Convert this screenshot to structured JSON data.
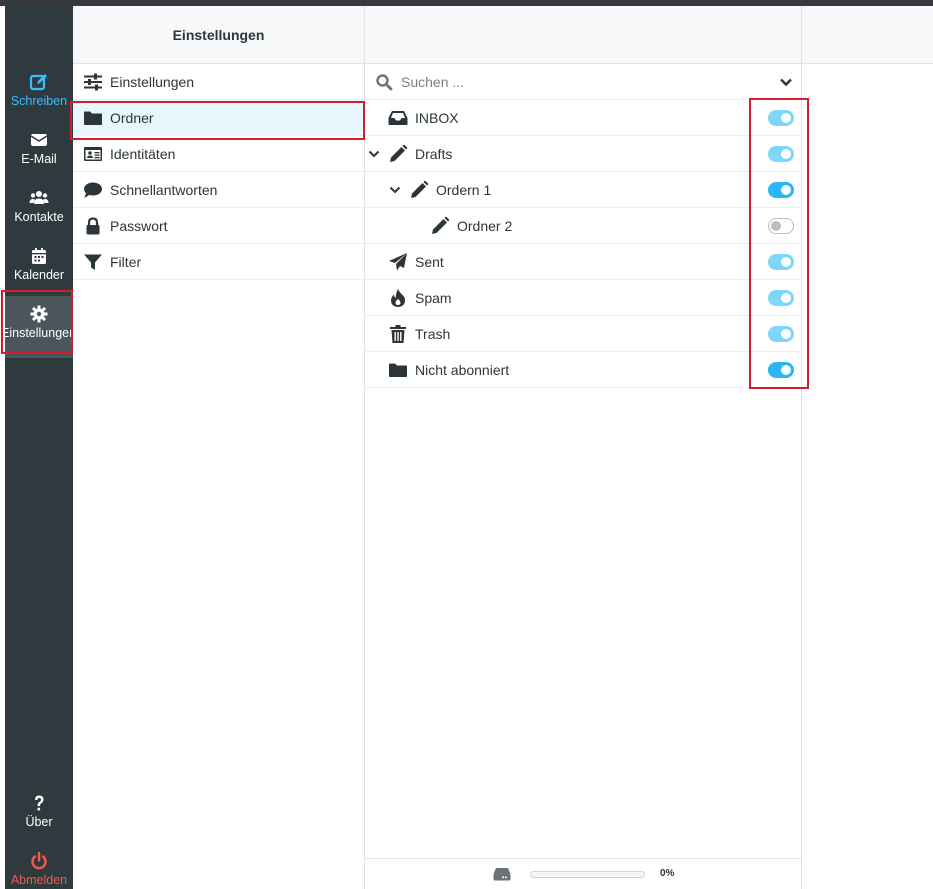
{
  "nav": {
    "compose": {
      "label": "Schreiben",
      "icon": "compose-icon"
    },
    "mail": {
      "label": "E-Mail",
      "icon": "envelope-icon"
    },
    "contacts": {
      "label": "Kontakte",
      "icon": "users-icon"
    },
    "calendar": {
      "label": "Kalender",
      "icon": "calendar-icon"
    },
    "settings": {
      "label": "Einstellungen",
      "icon": "gear-icon",
      "active": true
    },
    "about": {
      "label": "Über",
      "icon": "question-icon"
    },
    "logout": {
      "label": "Abmelden",
      "icon": "power-icon"
    }
  },
  "settings_column": {
    "title": "Einstellungen",
    "items": [
      {
        "label": "Einstellungen",
        "icon": "sliders-icon"
      },
      {
        "label": "Ordner",
        "icon": "folder-icon",
        "selected": true
      },
      {
        "label": "Identitäten",
        "icon": "id-card-icon"
      },
      {
        "label": "Schnellantworten",
        "icon": "comment-icon"
      },
      {
        "label": "Passwort",
        "icon": "lock-icon"
      },
      {
        "label": "Filter",
        "icon": "filter-icon"
      }
    ]
  },
  "folders": {
    "search_placeholder": "Suchen ...",
    "items": [
      {
        "name": "INBOX",
        "icon": "inbox-icon",
        "subscribed": true
      },
      {
        "name": "Drafts",
        "icon": "pencil-icon",
        "subscribed": true,
        "expanded": true
      },
      {
        "name": "Ordern 1",
        "icon": "pencil-icon",
        "subscribed": true,
        "expanded": true
      },
      {
        "name": "Ordner 2",
        "icon": "pencil-icon",
        "subscribed": false
      },
      {
        "name": "Sent",
        "icon": "paper-plane-icon",
        "subscribed": true
      },
      {
        "name": "Spam",
        "icon": "fire-icon",
        "subscribed": true
      },
      {
        "name": "Trash",
        "icon": "trash-icon",
        "subscribed": true
      },
      {
        "name": "Nicht abonniert",
        "icon": "folder-icon",
        "subscribed": true
      }
    ]
  },
  "quota": {
    "percent_label": "0%",
    "fraction": 0.0
  },
  "colors": {
    "accent": "#37beff",
    "logout": "#f25a4c",
    "nav_bg": "#2f3a3f",
    "highlight": "#d21f2f"
  }
}
